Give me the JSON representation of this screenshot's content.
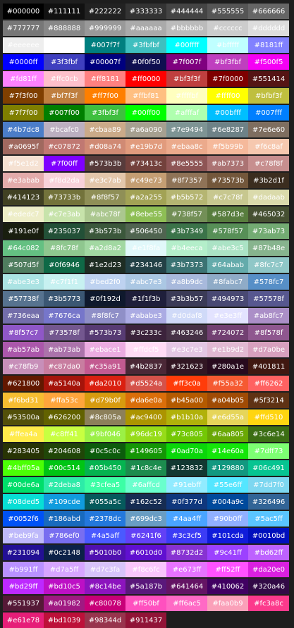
{
  "swatches": [
    "#000000",
    "#111111",
    "#222222",
    "#333333",
    "#444444",
    "#555555",
    "#666666",
    "#777777",
    "#888888",
    "#999999",
    "#aaaaaa",
    "#bbbbbb",
    "#cccccc",
    "#dddddd",
    "#eeeeee",
    "#ffffff",
    "#007f7f",
    "#3fbfbf",
    "#00ffff",
    "#bfffff",
    "#8181ff",
    "#0000ff",
    "#3f3fbf",
    "#00007f",
    "#0f0f50",
    "#7f007f",
    "#bf3fbf",
    "#f500f5",
    "#fd81ff",
    "#ffc0cb",
    "#ff8181",
    "#ff0000",
    "#bf3f3f",
    "#7f0000",
    "#551414",
    "#7f3f00",
    "#bf7f3f",
    "#ff7f00",
    "#ffbf81",
    "#ffffbf",
    "#ffff00",
    "#bfbf3f",
    "#7f7f00",
    "#007f00",
    "#3fbf3f",
    "#00ff00",
    "#afffaf",
    "#00bfff",
    "#007fff",
    "#4b7dc8",
    "#bcafc0",
    "#cbaa89",
    "#a6a090",
    "#7e9494",
    "#6e8287",
    "#7e6e60",
    "#a0695f",
    "#c07872",
    "#d08a74",
    "#e19b7d",
    "#ebaa8c",
    "#f5b99b",
    "#f6c8af",
    "#f5e1d2",
    "#7f00ff",
    "#573b3b",
    "#73413c",
    "#8e5555",
    "#ab7373",
    "#c78f8f",
    "#e3abab",
    "#f8d2da",
    "#e3c7ab",
    "#c49e73",
    "#8f7357",
    "#73573b",
    "#3b2d1f",
    "#414123",
    "#73733b",
    "#8f8f57",
    "#a2a255",
    "#b5b572",
    "#c7c78f",
    "#dadaab",
    "#ededc7",
    "#c7e3ab",
    "#abc78f",
    "#8ebe55",
    "#738f57",
    "#587d3e",
    "#465032",
    "#191e0f",
    "#235037",
    "#3b573b",
    "#506450",
    "#3b7349",
    "#578f57",
    "#73ab73",
    "#64c082",
    "#8fc78f",
    "#a2d8a2",
    "#e1f8fa",
    "#b4eeca",
    "#abe3c5",
    "#87b48e",
    "#507d5f",
    "#0f6946",
    "#1e2d23",
    "#234146",
    "#3b7373",
    "#64abab",
    "#8fc7c7",
    "#abe3e3",
    "#c7f1f1",
    "#bed2f0",
    "#abc7e3",
    "#a8b9dc",
    "#8fabc7",
    "#578fc7",
    "#57738f",
    "#3b5773",
    "#0f192d",
    "#1f1f3b",
    "#3b3b57",
    "#494973",
    "#57578f",
    "#736eaa",
    "#7676ca",
    "#8f8fc7",
    "#ababe3",
    "#d0daf8",
    "#e3e3ff",
    "#ab8fc7",
    "#8f57c7",
    "#73578f",
    "#573b73",
    "#3c233c",
    "#463246",
    "#724072",
    "#8f578f",
    "#ab57ab",
    "#ab73ab",
    "#ebace1",
    "#ffdcf5",
    "#e3c7e3",
    "#e1b9d2",
    "#d7a0be",
    "#c78fb9",
    "#c87da0",
    "#c35a91",
    "#4b2837",
    "#321623",
    "#280a1e",
    "#401811",
    "#621800",
    "#a5140a",
    "#da2010",
    "#d5524a",
    "#ff3c0a",
    "#f55a32",
    "#ff6262",
    "#f6bd31",
    "#ffa53c",
    "#d79b0f",
    "#da6e0a",
    "#b45a00",
    "#a04b05",
    "#5f3214",
    "#53500a",
    "#626200",
    "#8c805a",
    "#ac9400",
    "#b1b10a",
    "#e6d55a",
    "#ffd510",
    "#ffea4a",
    "#c8ff41",
    "#9bf046",
    "#96dc19",
    "#73c805",
    "#6aa805",
    "#3c6e14",
    "#283405",
    "#204608",
    "#0c5c0c",
    "#149605",
    "#0ad70a",
    "#14e60a",
    "#7dff73",
    "#4bff05a",
    "#00c514",
    "#05b450",
    "#1c8c4e",
    "#123832",
    "#129880",
    "#06c491",
    "#00de6a",
    "#2deba8",
    "#3cfea5",
    "#6affcd",
    "#91ebff",
    "#55e6ff",
    "#7dd7f0",
    "#08ded5",
    "#109cde",
    "#055a5c",
    "#162c52",
    "#0f377d",
    "#004a9c",
    "#326496",
    "#0052f6",
    "#186abd",
    "#2378dc",
    "#699dc3",
    "#4aa4ff",
    "#90b0ff",
    "#5ac5ff",
    "#beb9fa",
    "#786ef0",
    "#4a5aff",
    "#6241f6",
    "#3c3cf5",
    "#101cda",
    "#0010bd",
    "#231094",
    "#0c2148",
    "#5010b0",
    "#6010d0",
    "#8732d2",
    "#9c41ff",
    "#bd62ff",
    "#b991ff",
    "#d7a5ff",
    "#d7c3fa",
    "#f8c6fc",
    "#e673ff",
    "#ff52ff",
    "#da20e0",
    "#bd29ff",
    "#bd10c5",
    "#8c14be",
    "#5a187b",
    "#641464",
    "#410062",
    "#320a46",
    "#551937",
    "#a01982",
    "#c80078",
    "#ff50bf",
    "#ff6ac5",
    "#faa0b9",
    "#fc3a8c",
    "#e61e78",
    "#bd1039",
    "#98344d",
    "#911437"
  ]
}
